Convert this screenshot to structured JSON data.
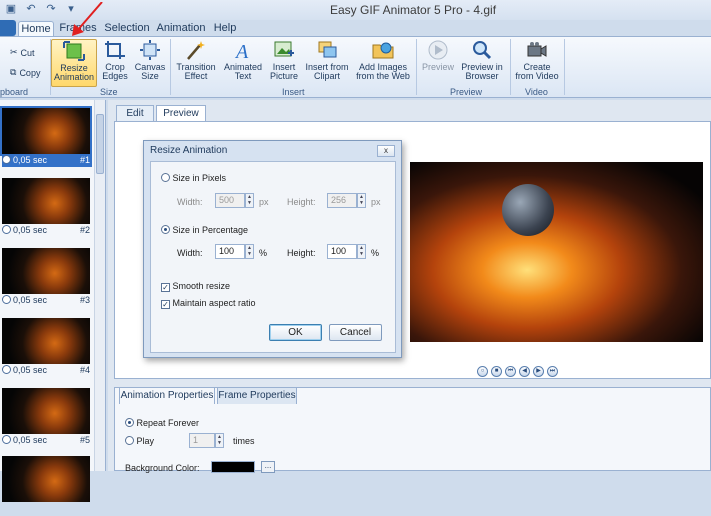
{
  "window": {
    "title": "Easy GIF Animator 5 Pro - 4.gif"
  },
  "qat_icons": [
    "save-icon",
    "undo-icon",
    "redo-icon",
    "customize-icon"
  ],
  "ribbon_tabs": [
    {
      "label": "Home",
      "active": true
    },
    {
      "label": "Frames",
      "active": false
    },
    {
      "label": "Selection",
      "active": false
    },
    {
      "label": "Animation",
      "active": false
    },
    {
      "label": "Help",
      "active": false
    }
  ],
  "ribbon": {
    "clipboard": {
      "cut": "Cut",
      "copy": "Copy",
      "group": "pboard"
    },
    "size": {
      "resize": "Resize\nAnimation",
      "crop": "Crop\nEdges",
      "canvas": "Canvas\nSize",
      "group": "Size"
    },
    "insert": {
      "transition": "Transition\nEffect",
      "animated_text": "Animated\nText",
      "picture": "Insert\nPicture",
      "clipart": "Insert from\nClipart",
      "web": "Add Images\nfrom the Web",
      "group": "Insert"
    },
    "preview": {
      "preview": "Preview",
      "browser": "Preview in\nBrowser",
      "group": "Preview"
    },
    "video": {
      "create": "Create\nfrom Video",
      "group": "Video"
    }
  },
  "frames": [
    {
      "time": "0,05 sec",
      "num": "#1",
      "selected": true
    },
    {
      "time": "0,05 sec",
      "num": "#2",
      "selected": false
    },
    {
      "time": "0,05 sec",
      "num": "#3",
      "selected": false
    },
    {
      "time": "0,05 sec",
      "num": "#4",
      "selected": false
    },
    {
      "time": "0,05 sec",
      "num": "#5",
      "selected": false
    }
  ],
  "editor_tabs": [
    {
      "label": "Edit",
      "active": false
    },
    {
      "label": "Preview",
      "active": true
    }
  ],
  "dialog": {
    "title": "Resize Animation",
    "close": "x",
    "size_pixels": "Size in Pixels",
    "width_label": "Width:",
    "height_label": "Height:",
    "pixel_width": "500",
    "pixel_height": "256",
    "px_unit": "px",
    "size_percentage": "Size in Percentage",
    "percent_width": "100",
    "percent_height": "100",
    "percent_unit": "%",
    "smooth_resize": "Smooth resize",
    "maintain_aspect": "Maintain aspect ratio",
    "ok": "OK",
    "cancel": "Cancel",
    "selected_mode": "percentage"
  },
  "properties": {
    "tabs": [
      {
        "label": "Animation Properties",
        "active": true
      },
      {
        "label": "Frame Properties",
        "active": false
      }
    ],
    "repeat_forever": "Repeat Forever",
    "play": "Play",
    "play_count": "1",
    "times": "times",
    "background_color": "Background Color:",
    "color_button": "...",
    "background_color_value": "#000000"
  },
  "colors": {
    "accent": "#3371c8",
    "ribbon_bg": "#dbe6f4",
    "selected_button": "#ffd86b",
    "arrow": "#e02020"
  }
}
